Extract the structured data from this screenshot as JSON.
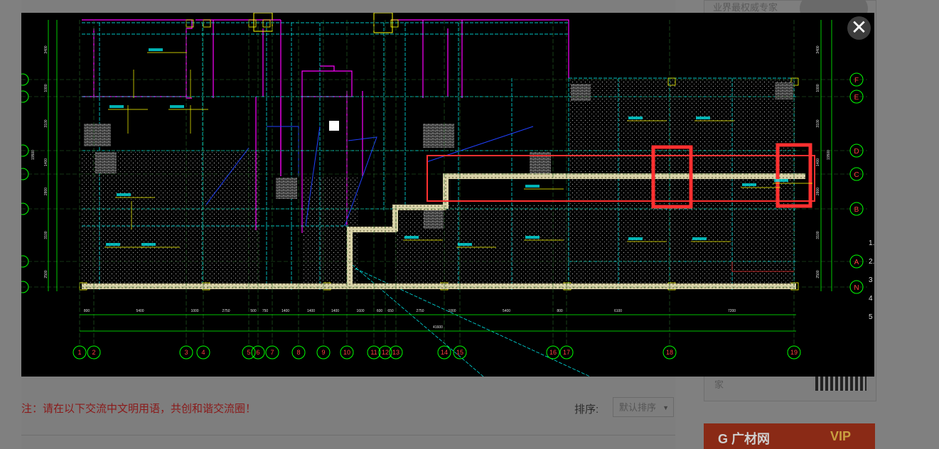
{
  "page": {
    "note": "注：请在以下交流中文明用语，共创和谐交流圈！",
    "sort_label": "排序:",
    "sort_value": "默认排序",
    "close_symbol": "✕"
  },
  "sidebar": {
    "top_text": "业界最权威专家",
    "bottom_text": "家",
    "banner_text": "G 广材网",
    "banner_vip": "VIP"
  },
  "drawing": {
    "row_axes": [
      "F",
      "E",
      "D",
      "C",
      "B",
      "A",
      "N"
    ],
    "col_axes": [
      "1",
      "2",
      "3",
      "4",
      "5",
      "6",
      "7",
      "8",
      "9",
      "10",
      "11",
      "12",
      "13",
      "14",
      "15",
      "16",
      "17",
      "18",
      "19"
    ],
    "bottom_dims": [
      "800",
      "5400",
      "1000",
      "2750",
      "500",
      "750",
      "1400",
      "1400",
      "1400",
      "1600",
      "600",
      "650",
      "2750",
      "1000",
      "5400",
      "800",
      "6100",
      "7200"
    ],
    "total_dim": "41600",
    "left_dims": [
      "3400",
      "1000",
      "3100",
      "1400",
      "2800",
      "3100",
      "2500",
      "19500"
    ],
    "right_dims": [
      "3400",
      "1000",
      "3100",
      "1400",
      "2800",
      "3100",
      "2500",
      "19500"
    ],
    "right_edge_chars": [
      "1.",
      "2.",
      "3",
      "4",
      "5"
    ]
  },
  "colors": {
    "cad_bg": "#000000",
    "axis_green": "#00ff00",
    "wall_cyan": "#00ffff",
    "wall_magenta": "#ff00ff",
    "beam_yellow": "#ffff00",
    "highlight_red": "#ff3030",
    "note_red": "#8a1a1a"
  }
}
